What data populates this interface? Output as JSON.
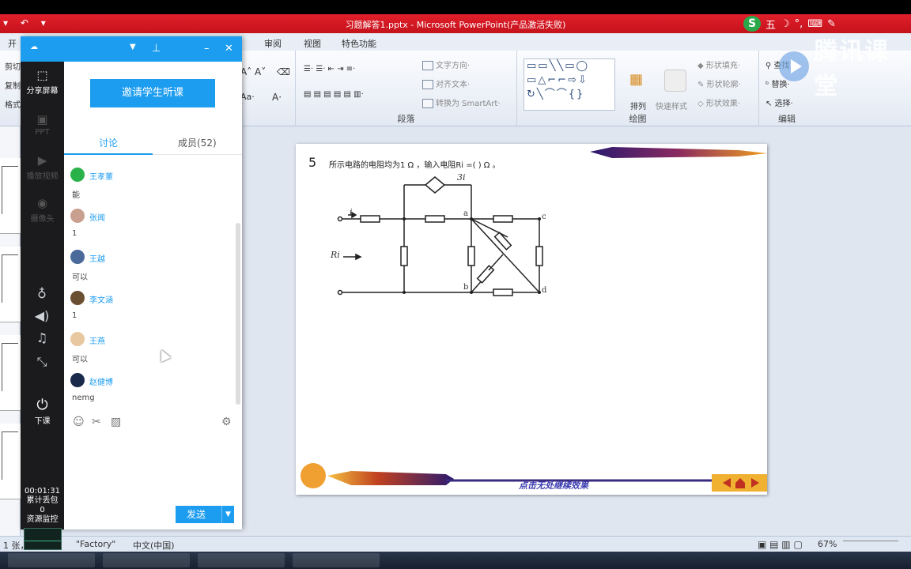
{
  "window": {
    "title": "习题解答1.pptx - Microsoft PowerPoint(产品激活失败)",
    "ime_label": "五",
    "watermark": "腾讯课堂"
  },
  "ribbon": {
    "tabs": [
      "开",
      "审阅",
      "视图",
      "特色功能"
    ],
    "font_btns": [
      "A˄ A˅",
      "Aa·",
      "A·"
    ],
    "paragraph": {
      "label": "段落",
      "text_direction": "文字方向·",
      "align_text": "对齐文本·",
      "smartart": "转换为 SmartArt·"
    },
    "drawing": {
      "label": "绘图",
      "arrange": "排列",
      "quick_styles": "快速样式",
      "shape_fill": "形状填充·",
      "shape_outline": "形状轮廓·",
      "shape_effects": "形状效果·"
    },
    "editing": {
      "label": "编辑",
      "find": "查找",
      "replace": "替换·",
      "select": "选择·"
    },
    "left_clip": [
      "剪切",
      "复制",
      "格式"
    ]
  },
  "tc_panel": {
    "sidebar": {
      "share_screen": "分享屏幕",
      "ppt": "PPT",
      "play_video": "播放视频",
      "camera": "摄像头",
      "end_class": "下课",
      "timer": "00:01:31",
      "cumulative_label": "累计丢包",
      "cumulative_value": "0",
      "resource_monitor": "资源监控"
    },
    "invite_button": "邀请学生听课",
    "tabs": {
      "discuss": "讨论",
      "members": "成员(52)"
    },
    "messages": [
      {
        "name": "王孝董",
        "text": "能",
        "avatar_color": "#2ab24a"
      },
      {
        "name": "张闻",
        "text": "1",
        "avatar_color": "#c9a090"
      },
      {
        "name": "王越",
        "text": "可以",
        "avatar_color": "#4a6a9a"
      },
      {
        "name": "李文涵",
        "text": "1",
        "avatar_color": "#6a5030"
      },
      {
        "name": "王燕",
        "text": "可以",
        "avatar_color": "#e8c8a0"
      },
      {
        "name": "赵健博",
        "text": "nemg",
        "avatar_color": "#1a2a4a"
      }
    ],
    "send_button": "发送"
  },
  "slide": {
    "number": "5",
    "question": "所示电路的电阻均为1 Ω ，输入电阻Ri =(    ) Ω 。",
    "footer": "点击无处继续效果",
    "circuit_labels": {
      "source": "3i",
      "current": "i",
      "node_a": "a",
      "node_b": "b",
      "node_c": "c",
      "node_d": "d",
      "input": "Ri"
    }
  },
  "status": {
    "slide_pos": "1 张，共 5 张",
    "theme": "\"Factory\"",
    "lang": "中文(中国)",
    "zoom": "67%"
  }
}
